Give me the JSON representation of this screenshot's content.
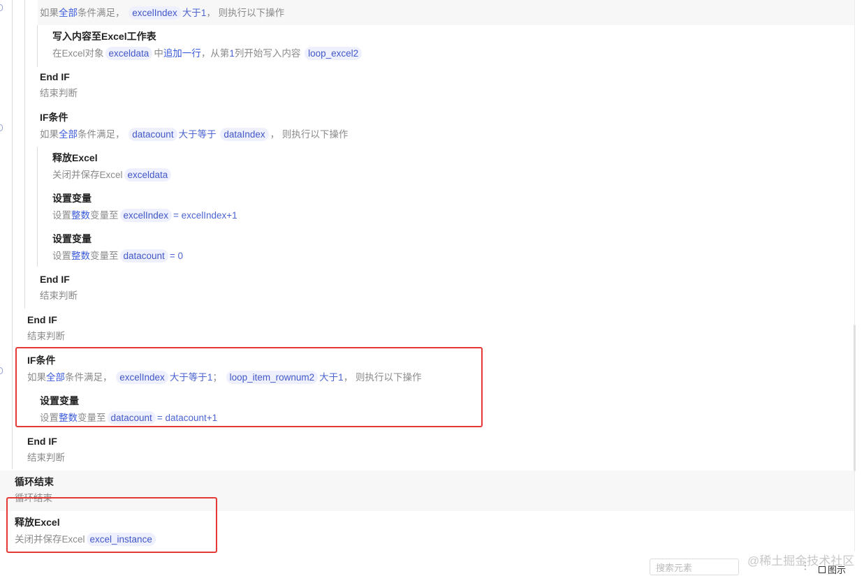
{
  "rows": {
    "r0": {
      "d": [
        "如果",
        "全部",
        "条件满足，",
        "excelIndex",
        "大于",
        "1",
        "，",
        "则执行以下操作"
      ]
    },
    "r1": {
      "t": "写入内容至Excel工作表",
      "d": [
        "在Excel对象",
        "exceldata",
        "中",
        "追加一行",
        "，从第",
        "1",
        "列开始写入内容",
        "loop_excel2"
      ]
    },
    "r2": {
      "t": "End IF",
      "d": "结束判断"
    },
    "r3": {
      "t": "IF条件",
      "d": [
        "如果",
        "全部",
        "条件满足，",
        "datacount",
        "大于等于",
        "dataIndex",
        "，",
        "则执行以下操作"
      ]
    },
    "r4": {
      "t": "释放Excel",
      "d": [
        "关闭并保存Excel",
        "exceldata"
      ]
    },
    "r5": {
      "t": "设置变量",
      "d": [
        "设置",
        "整数",
        "变量至",
        "excelIndex",
        "= excelIndex+1"
      ]
    },
    "r6": {
      "t": "设置变量",
      "d": [
        "设置",
        "整数",
        "变量至",
        "datacount",
        "= 0"
      ]
    },
    "r7": {
      "t": "End IF",
      "d": "结束判断"
    },
    "r8": {
      "t": "End IF",
      "d": "结束判断"
    },
    "r9": {
      "t": "IF条件",
      "d": [
        "如果",
        "全部",
        "条件满足，",
        "excelIndex",
        "大于等于",
        "1",
        "；",
        "loop_item_rownum2",
        "大于",
        "1",
        "，",
        "则执行以下操作"
      ]
    },
    "r10": {
      "t": "设置变量",
      "d": [
        "设置",
        "整数",
        "变量至",
        "datacount",
        "= datacount+1"
      ]
    },
    "r11": {
      "t": "End IF",
      "d": "结束判断"
    },
    "r12": {
      "t": "循环结束",
      "d": "循环结束"
    },
    "r13": {
      "t": "释放Excel",
      "d": [
        "关闭并保存Excel",
        "excel_instance"
      ]
    }
  },
  "search": {
    "placeholder": "搜索元素"
  },
  "legend_label": "图示",
  "watermark": "@稀土掘金技术社区",
  "colors": {
    "highlight": "#e53935",
    "variable_pill_bg": "#eef0fd",
    "keyword": "#3b5bdb"
  }
}
